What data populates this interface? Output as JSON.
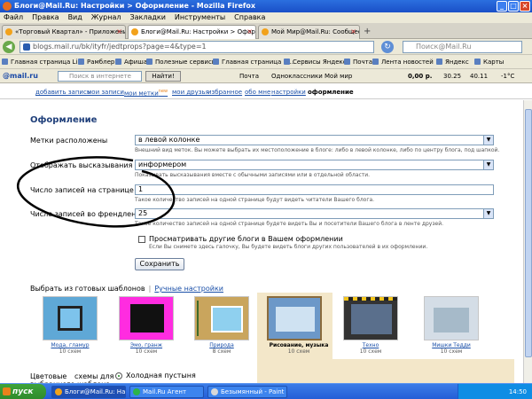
{
  "window": {
    "title": "Блоги@Mail.Ru: Настройки > Оформление - Mozilla Firefox"
  },
  "menu": [
    "Файл",
    "Правка",
    "Вид",
    "Журнал",
    "Закладки",
    "Инструменты",
    "Справка"
  ],
  "tabs": [
    {
      "label": "«Торговый Квартал» - Приложения - М..."
    },
    {
      "label": "Блоги@Mail.Ru: Настройки > Оформле..."
    },
    {
      "label": "Мой Мир@Mail.Ru: Сообщество: Блоги..."
    }
  ],
  "nav": {
    "url": "blogs.mail.ru/bk/ityfr/jedtprops?page=4&type=1",
    "search_placeholder": "Поиск@Mail.Ru"
  },
  "bookmarks": [
    "Главная страница Li...",
    "Рамблер",
    "Афиша",
    "Полезные сервисы",
    "Главная страница Я...",
    "Сервисы Яндекса",
    "Почта",
    "Лента новостей",
    "Яндекс",
    "Карты"
  ],
  "mailbar": {
    "logo": "@mail.ru",
    "search_placeholder": "Поиск в интернете",
    "find": "Найти!",
    "items": [
      "Почта",
      "Одноклассники",
      "Мой мир",
      "0,00 р.",
      "30.25",
      "40.11",
      "-1°С"
    ]
  },
  "pagenav": {
    "items": [
      "добавить запись",
      "мои записи",
      "мои метки",
      "мои друзья",
      "избранное",
      "обо мне",
      "настройки",
      "оформление"
    ],
    "new_badge": "new"
  },
  "form": {
    "heading": "Оформление",
    "rows": [
      {
        "label": "Метки расположены",
        "value": "в левой колонке",
        "hint": "Внешний вид меток. Вы можете выбрать их местоположение в блоге: либо в левой колонке, либо по центру блога, под шапкой."
      },
      {
        "label": "Отображать высказывания",
        "value": "информером",
        "hint": "Показывать высказывания вместе с обычными записями или в отдельной области."
      },
      {
        "label": "Число записей на странице блога",
        "value": "1",
        "hint": "Такое количество записей на одной странице будут видеть читатели Вашего блога."
      },
      {
        "label": "Число записей во френдленте",
        "value": "25",
        "hint": "Такое количество записей на одной странице будете видеть Вы и посетители Вашего блога в ленте друзей."
      }
    ],
    "checkbox_label": "Просматривать другие блоги в Вашем оформлении",
    "checkbox_hint": "Если Вы снимете здесь галочку, Вы будете видеть блоги других пользователей в их оформлении.",
    "save": "Сохранить"
  },
  "templates": {
    "choose_label": "Выбрать из готовых шаблонов",
    "custom_link": "Ручные настройки",
    "items": [
      {
        "name": "Мода, гламур",
        "count": "10 схем"
      },
      {
        "name": "Эмо, гранж",
        "count": "10 схем"
      },
      {
        "name": "Природа",
        "count": "8 схем"
      },
      {
        "name": "Рисование, музыка",
        "count": "10 схем"
      },
      {
        "name": "Техно",
        "count": "10 схем"
      },
      {
        "name": "Мишки Тедди",
        "count": "10 схем"
      }
    ],
    "scheme_label_1": "Цветовые",
    "scheme_label_1b": "схемы для",
    "scheme_label_2": "выбранного шаблона",
    "scheme_option": "Холодная пустыня"
  },
  "taskbar": {
    "start": "пуск",
    "tasks": [
      "Блоги@Mail.Ru: Нас...",
      "Mail.Ru Агент",
      "Безымянный - Paint"
    ],
    "time": "14:50"
  }
}
